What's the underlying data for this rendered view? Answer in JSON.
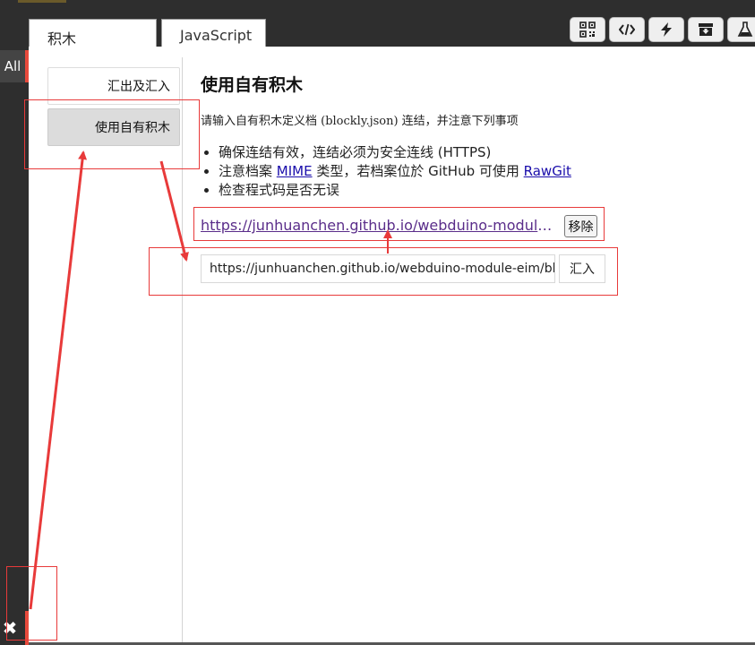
{
  "tabs": [
    {
      "label": "积木"
    },
    {
      "label": "JavaScript"
    }
  ],
  "toolbar": {
    "icons": [
      "qr-code-icon",
      "code-icon",
      "lightning-icon",
      "archive-download-icon",
      "flask-icon"
    ]
  },
  "rail": {
    "all_label": "All",
    "close_glyph": "✖"
  },
  "sidebar": {
    "items": [
      {
        "label": "汇出及汇入"
      },
      {
        "label": "使用自有积木"
      }
    ]
  },
  "content": {
    "title": "使用自有积木",
    "description": "请输入自有积木定义档 (blockly.json) 连结，并注意下列事项",
    "notes": [
      {
        "text": "确保连结有效，连结必须为安全连线 (HTTPS)"
      },
      {
        "prefix": "注意档案 ",
        "link": "MIME",
        "middle": " 类型，若档案位於 GitHub 可使用 ",
        "link2": "RawGit"
      },
      {
        "text": "检查程式码是否无误"
      }
    ],
    "url_link": "https://junhuanchen.github.io/webduino-module-eim/blockly.json",
    "remove_label": "移除",
    "input_value": "https://junhuanchen.github.io/webduino-module-eim/bloc",
    "import_label": "汇入"
  },
  "colors": {
    "annotation": "#e83a3a",
    "rail_accent": "#e84a3c"
  }
}
